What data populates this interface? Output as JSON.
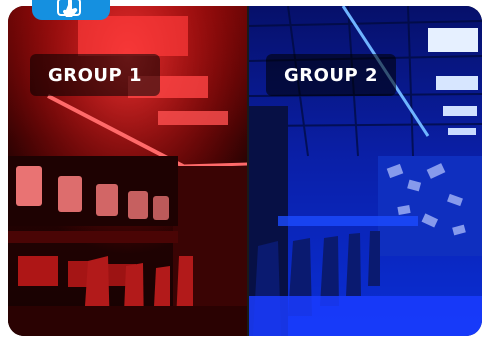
{
  "groups": [
    {
      "label": "GROUP 1",
      "lighting": "red"
    },
    {
      "label": "GROUP 2",
      "lighting": "blue"
    }
  ],
  "colors": {
    "badge": "#1590e0",
    "red_accent": "#ff2a2a",
    "blue_accent": "#2f7bff"
  },
  "badge_icon": "hand-tap-icon"
}
